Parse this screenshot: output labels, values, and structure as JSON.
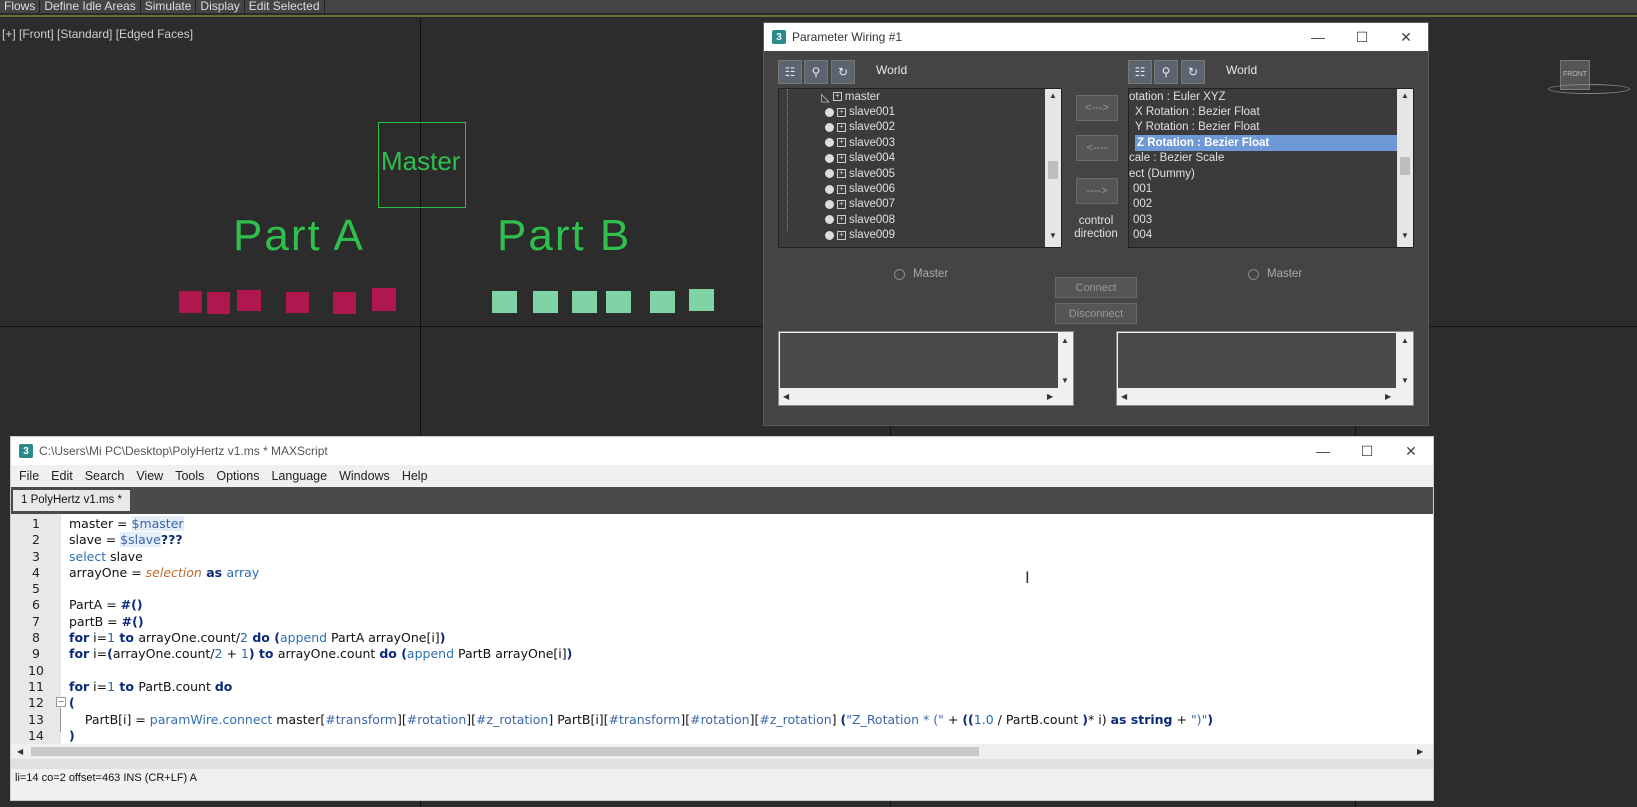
{
  "top_menu": [
    "Flows",
    "Define Idle Areas",
    "Simulate",
    "Display",
    "Edit Selected"
  ],
  "viewport": {
    "label": "[+] [Front] [Standard] [Edged Faces]",
    "master_text": "Master",
    "part_a": "Part A",
    "part_b": "Part B",
    "viewcube_label": "FRONT"
  },
  "param_wiring": {
    "title": "Parameter Wiring #1",
    "left_space": "World",
    "right_space": "World",
    "left_tree": [
      "master",
      "slave001",
      "slave002",
      "slave003",
      "slave004",
      "slave005",
      "slave006",
      "slave007",
      "slave008",
      "slave009"
    ],
    "right_tree": [
      "otation : Euler XYZ",
      "X Rotation : Bezier Float",
      "Y Rotation : Bezier Float",
      "Z Rotation : Bezier Float",
      "cale : Bezier Scale",
      "ect (Dummy)",
      "001",
      "002",
      "003",
      "004"
    ],
    "arrow_both": "<--->",
    "arrow_left": "<----",
    "arrow_right": "---->",
    "control_direction": "control direction",
    "left_master": "Master",
    "right_master": "Master",
    "connect": "Connect",
    "disconnect": "Disconnect"
  },
  "maxscript": {
    "title": "C:\\Users\\Mi PC\\Desktop\\PolyHertz v1.ms * MAXScript",
    "menu": [
      "File",
      "Edit",
      "Search",
      "View",
      "Tools",
      "Options",
      "Language",
      "Windows",
      "Help"
    ],
    "tab": "1 PolyHertz v1.ms *",
    "line_numbers": [
      "1",
      "2",
      "3",
      "4",
      "5",
      "6",
      "7",
      "8",
      "9",
      "10",
      "11",
      "12",
      "13",
      "14"
    ],
    "code": {
      "l1_a": "master = ",
      "l1_b": "$master",
      "l2_a": "slave = ",
      "l2_b": "$slave",
      "l2_c": "???",
      "l3_a": "select",
      "l3_b": " slave",
      "l4_a": "arrayOne = ",
      "l4_b": "selection",
      "l4_c": " as ",
      "l4_d": "array",
      "l6_a": "PartA = ",
      "l6_b": "#()",
      "l7_a": "partB = ",
      "l7_b": "#()",
      "l8_a": "for",
      "l8_b": " i=",
      "l8_c": "1",
      "l8_d": " to ",
      "l8_e": "arrayOne.count/",
      "l8_f": "2",
      "l8_g": " do ",
      "l8_h": "(",
      "l8_i": "append",
      "l8_j": " PartA arrayOne[i]",
      "l8_k": ")",
      "l9_a": "for",
      "l9_b": " i=",
      "l9_c": "(",
      "l9_d": "arrayOne.count/",
      "l9_e": "2",
      "l9_f": " + ",
      "l9_g": "1",
      "l9_h": ")",
      "l9_i": " to ",
      "l9_j": "arrayOne.count ",
      "l9_k": "do ",
      "l9_l": "(",
      "l9_m": "append",
      "l9_n": " PartB arrayOne[i]",
      "l9_o": ")",
      "l11_a": "for",
      "l11_b": " i=",
      "l11_c": "1",
      "l11_d": " to ",
      "l11_e": "PartB.count ",
      "l11_f": "do",
      "l12": "(",
      "l13_a": "    PartB[i] = ",
      "l13_b": "paramWire.connect",
      "l13_c": " master[",
      "l13_d": "#transform",
      "l13_e": "][",
      "l13_f": "#rotation",
      "l13_g": "][",
      "l13_h": "#z_rotation",
      "l13_i": "] PartB[i][",
      "l13_j": "#transform",
      "l13_k": "][",
      "l13_l": "#rotation",
      "l13_m": "][",
      "l13_n": "#z_rotation",
      "l13_o": "] ",
      "l13_p": "(",
      "l13_q": "\"Z_Rotation * (\"",
      "l13_r": " + ",
      "l13_s": "((",
      "l13_t": "1.0",
      "l13_u": " / PartB.count ",
      "l13_v": ")",
      "l13_w": "* i) ",
      "l13_x": "as string",
      "l13_y": " + ",
      "l13_z": "\")\"",
      "l13_end": ")",
      "l14": ")"
    },
    "status": "li=14 co=2 offset=463 INS (CR+LF) A"
  },
  "colors": {
    "green": "#2fbf4c",
    "pink": "#b0174f",
    "mint": "#7fd3a4",
    "selection": "#6f98d6"
  }
}
